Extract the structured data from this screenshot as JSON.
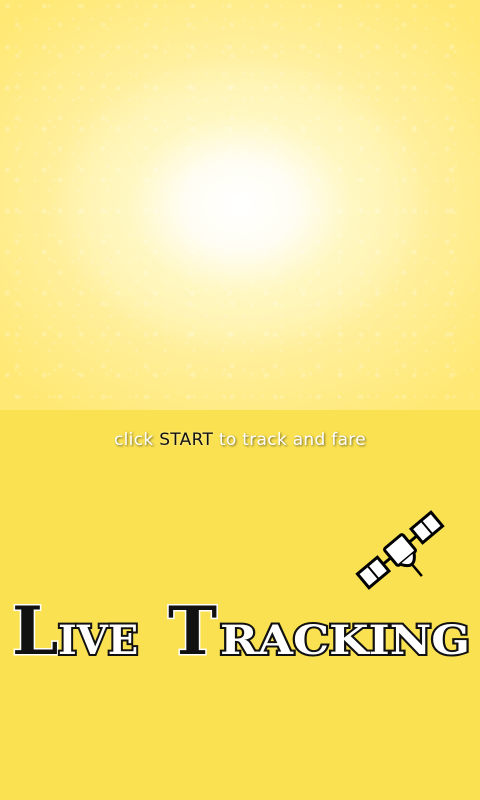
{
  "screen": {
    "background_color": "#fae151",
    "top_panel_color": "#fff7c0"
  },
  "instruction": {
    "prefix": "click",
    "keyword": "START",
    "suffix": "to track and fare"
  },
  "logo": {
    "title_word1_initial": "L",
    "title_word1_rest": "IVE",
    "title_word2_initial": "T",
    "title_word2_rest": "RACKING",
    "icon": "satellite-icon",
    "text_color": "#111111",
    "outline_color": "#ffffff"
  }
}
